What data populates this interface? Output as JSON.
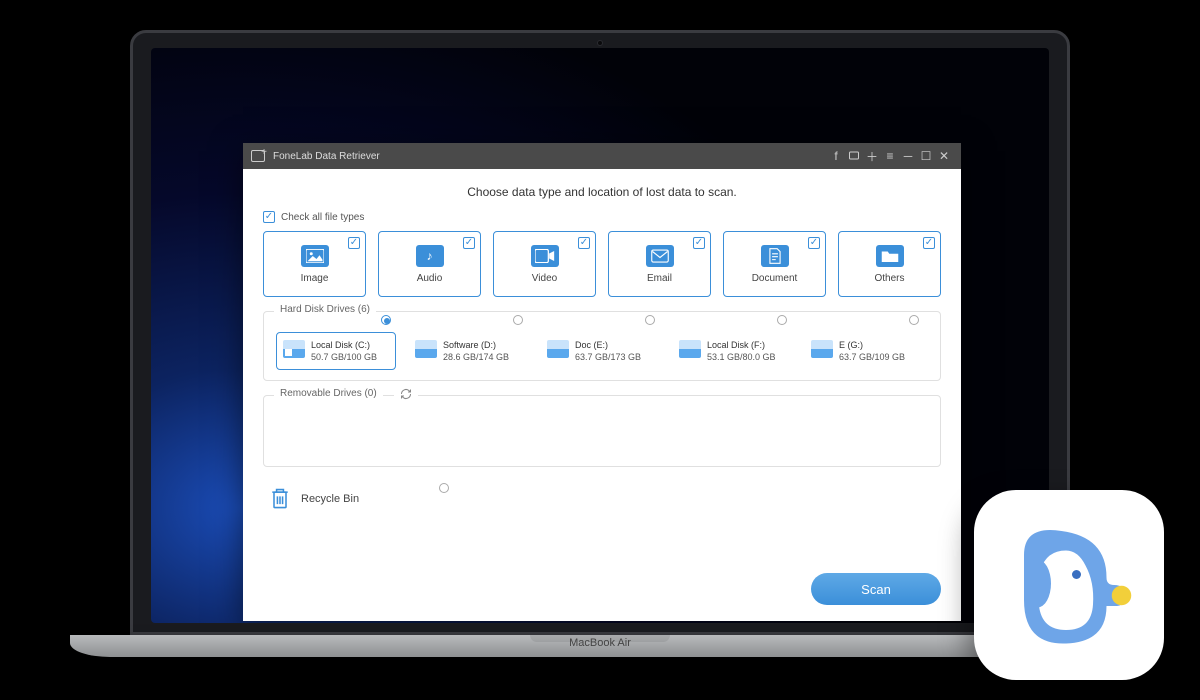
{
  "laptop": {
    "model": "MacBook Air"
  },
  "window": {
    "title": "FoneLab Data Retriever"
  },
  "heading": "Choose data type and location of lost data to scan.",
  "check_all_label": "Check all file types",
  "types": [
    {
      "label": "Image"
    },
    {
      "label": "Audio"
    },
    {
      "label": "Video"
    },
    {
      "label": "Email"
    },
    {
      "label": "Document"
    },
    {
      "label": "Others"
    }
  ],
  "sections": {
    "hard_disk_title": "Hard Disk Drives (6)",
    "removable_title": "Removable Drives (0)"
  },
  "drives": [
    {
      "name": "Local Disk (C:)",
      "size": "50.7 GB/100 GB",
      "selected": true,
      "win": true
    },
    {
      "name": "Software (D:)",
      "size": "28.6 GB/174 GB",
      "selected": false,
      "win": false
    },
    {
      "name": "Doc (E:)",
      "size": "63.7 GB/173 GB",
      "selected": false,
      "win": false
    },
    {
      "name": "Local Disk (F:)",
      "size": "53.1 GB/80.0 GB",
      "selected": false,
      "win": false
    },
    {
      "name": "E (G:)",
      "size": "63.7 GB/109 GB",
      "selected": false,
      "win": false
    }
  ],
  "recycle_bin_label": "Recycle Bin",
  "scan_label": "Scan"
}
